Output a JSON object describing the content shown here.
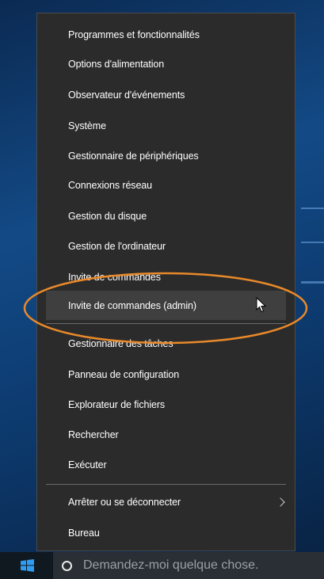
{
  "menu": {
    "items": [
      {
        "label": "Programmes et fonctionnalités"
      },
      {
        "label": "Options d'alimentation"
      },
      {
        "label": "Observateur d'événements"
      },
      {
        "label": "Système"
      },
      {
        "label": "Gestionnaire de périphériques"
      },
      {
        "label": "Connexions réseau"
      },
      {
        "label": "Gestion du disque"
      },
      {
        "label": "Gestion de l'ordinateur"
      },
      {
        "label": "Invite de commandes"
      },
      {
        "label": "Invite de commandes (admin)",
        "selected": true
      },
      {
        "label": "Gestionnaire des tâches"
      },
      {
        "label": "Panneau de configuration"
      },
      {
        "label": "Explorateur de fichiers"
      },
      {
        "label": "Rechercher"
      },
      {
        "label": "Exécuter"
      },
      {
        "label": "Arrêter ou se déconnecter",
        "has_submenu": true
      },
      {
        "label": "Bureau"
      }
    ]
  },
  "taskbar": {
    "search_placeholder": "Demandez-moi quelque chose."
  },
  "colors": {
    "menu_bg": "#2b2b2b",
    "selected_bg": "#3f3f3f",
    "highlight": "#e8892a"
  }
}
